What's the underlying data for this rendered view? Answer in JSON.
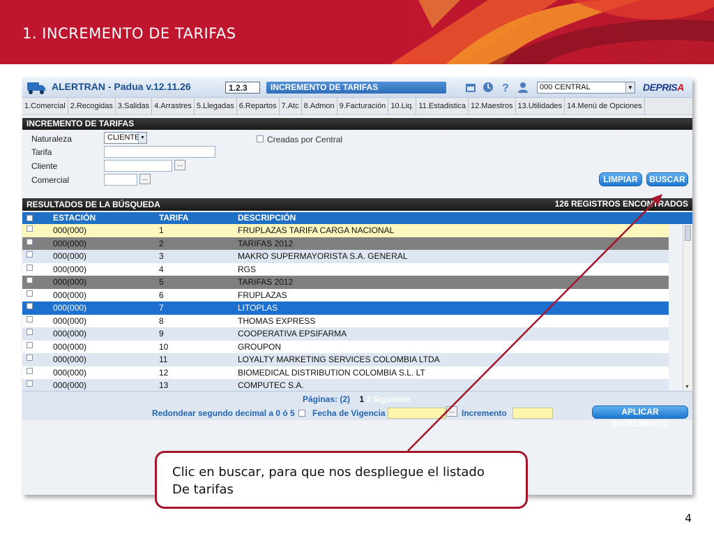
{
  "slide": {
    "title": "1. INCREMENTO DE TARIFAS",
    "page_number": "4",
    "callout_text": "Clic en buscar, para que nos despliegue el listado\nDe tarifas"
  },
  "app": {
    "name": "ALERTRAN - Padua  v.12.11.26",
    "screen_code": "1.2.3",
    "screen_name": "INCREMENTO DE TARIFAS",
    "center": "000 CENTRAL",
    "logo_main": "DEPRIS",
    "logo_accent": "A",
    "top_icons": [
      "calendar-icon",
      "clock-icon",
      "help-icon",
      "user-icon"
    ]
  },
  "menu": [
    "1.Comercial",
    "2.Recogidas",
    "3.Salidas",
    "4.Arrastres",
    "5.Llegadas",
    "6.Repartos",
    "7.Atc",
    "8.Admon",
    "9.Facturación",
    "10.Liq.",
    "11.Estadistica",
    "12.Maestros",
    "13.Utilidades",
    "14.Menú de Opciones"
  ],
  "form": {
    "section_title": "INCREMENTO DE TARIFAS",
    "naturaleza_label": "Naturaleza",
    "naturaleza_value": "CLIENTE",
    "tarifa_label": "Tarifa",
    "tarifa_value": "",
    "cliente_label": "Cliente",
    "cliente_value": "",
    "comercial_label": "Comercial",
    "comercial_value": "",
    "creadas_label": "Creadas por Central",
    "limpiar_label": "LIMPIAR",
    "buscar_label": "BUSCAR"
  },
  "results": {
    "section_title": "RESULTADOS DE LA BÚSQUEDA",
    "count_text": "126 REGISTROS ENCONTRADOS",
    "columns": [
      "ESTACIÓN",
      "TARIFA",
      "DESCRIPCIÓN"
    ],
    "rows": [
      {
        "estacion": "000(000)",
        "tarifa": "1",
        "descripcion": "FRUPLAZAS TARIFA CARGA NACIONAL",
        "style": "yellow"
      },
      {
        "estacion": "000(000)",
        "tarifa": "2",
        "descripcion": "TARIFAS 2012",
        "style": "gray"
      },
      {
        "estacion": "000(000)",
        "tarifa": "3",
        "descripcion": "MAKRO SUPERMAYORISTA S.A. GENERAL",
        "style": "light"
      },
      {
        "estacion": "000(000)",
        "tarifa": "4",
        "descripcion": "RGS",
        "style": "white"
      },
      {
        "estacion": "000(000)",
        "tarifa": "5",
        "descripcion": "TARIFAS 2012",
        "style": "gray"
      },
      {
        "estacion": "000(000)",
        "tarifa": "6",
        "descripcion": "FRUPLAZAS",
        "style": "white"
      },
      {
        "estacion": "000(000)",
        "tarifa": "7",
        "descripcion": "LITOPLAS",
        "style": "sel"
      },
      {
        "estacion": "000(000)",
        "tarifa": "8",
        "descripcion": "THOMAS EXPRESS",
        "style": "white"
      },
      {
        "estacion": "000(000)",
        "tarifa": "9",
        "descripcion": "COOPERATIVA EPSIFARMA",
        "style": "light"
      },
      {
        "estacion": "000(000)",
        "tarifa": "10",
        "descripcion": "GROUPON",
        "style": "white"
      },
      {
        "estacion": "000(000)",
        "tarifa": "11",
        "descripcion": "LOYALTY MARKETING SERVICES COLOMBIA LTDA",
        "style": "light"
      },
      {
        "estacion": "000(000)",
        "tarifa": "12",
        "descripcion": "BIOMEDICAL DISTRIBUTION COLOMBIA S.L. LT",
        "style": "white"
      },
      {
        "estacion": "000(000)",
        "tarifa": "13",
        "descripcion": "COMPUTEC S.A.",
        "style": "light"
      }
    ]
  },
  "footer": {
    "pages_label": "Páginas: (2)",
    "current_page": "1",
    "next_page": "2",
    "next_label": "Siguiente",
    "redondear_label": "Redondear segundo decimal a 0 ó 5",
    "fecha_label": "Fecha de Vigencia",
    "fecha_value": "",
    "incremento_label": "Incremento",
    "incremento_value": "",
    "aplicar_label": "APLICAR INCREMENTO"
  },
  "colors": {
    "brand_red": "#c0152f",
    "accent_blue": "#1f6fc6",
    "callout_border": "#a5162b"
  }
}
